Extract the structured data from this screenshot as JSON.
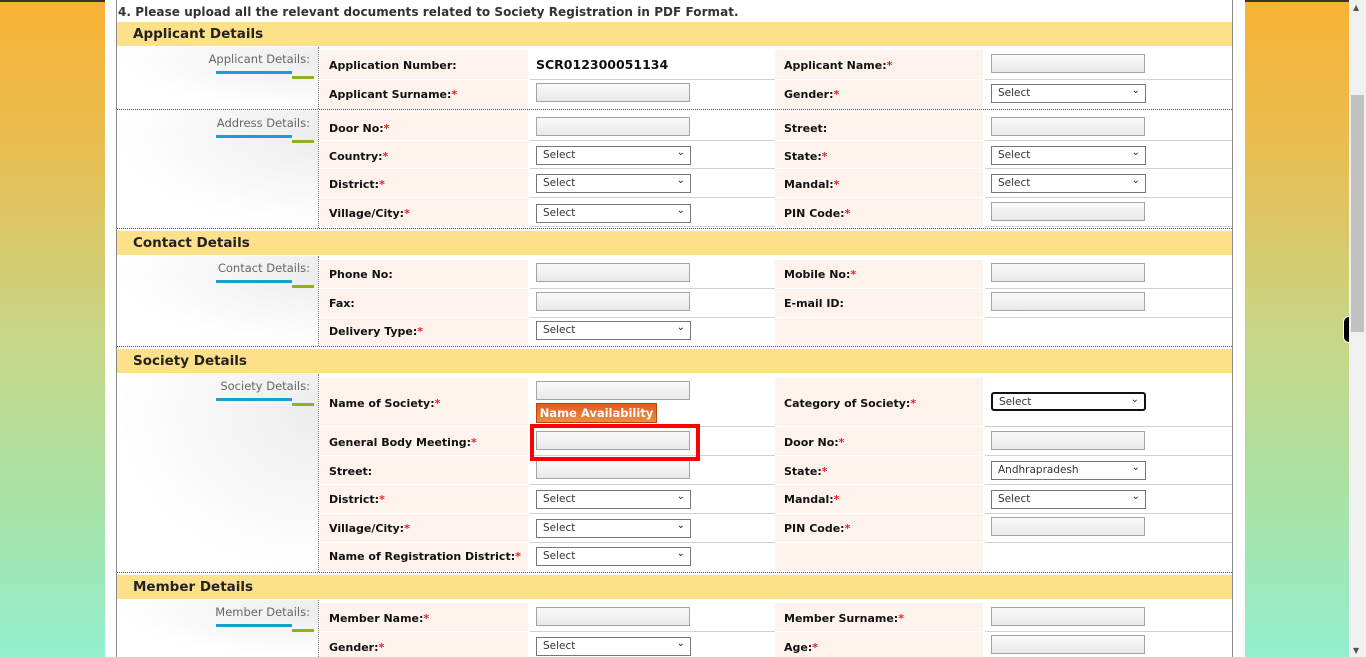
{
  "instruction_note": "4. Please upload all the relevant documents related to Society Registration in PDF Format.",
  "sections": {
    "applicant": {
      "header": "Applicant Details",
      "side_label": "Applicant Details:",
      "application_number_label": "Application Number:",
      "application_number_value": "SCR012300051134",
      "applicant_name_label": "Applicant Name:",
      "applicant_surname_label": "Applicant Surname:",
      "gender_label": "Gender:",
      "gender_value": "Select"
    },
    "address": {
      "side_label": "Address Details:",
      "door_label": "Door No:",
      "street_label": "Street:",
      "country_label": "Country:",
      "country_value": "Select",
      "state_label": "State:",
      "state_value": "Select",
      "district_label": "District:",
      "district_value": "Select",
      "mandal_label": "Mandal:",
      "mandal_value": "Select",
      "village_label": "Village/City:",
      "village_value": "Select",
      "pin_label": "PIN Code:"
    },
    "contact": {
      "header": "Contact Details",
      "side_label": "Contact Details:",
      "phone_label": "Phone No:",
      "mobile_label": "Mobile No:",
      "fax_label": "Fax:",
      "email_label": "E-mail ID:",
      "delivery_label": "Delivery Type:",
      "delivery_value": "Select"
    },
    "society": {
      "header": "Society Details",
      "side_label": "Society Details:",
      "name_label": "Name of  Society:",
      "name_availability_button": "Name Availability",
      "category_label": "Category of Society:",
      "category_value": "Select",
      "gbm_label": "General Body Meeting:",
      "door_label": "Door No:",
      "street_label": "Street:",
      "state_label": "State:",
      "state_value": "Andhrapradesh",
      "district_label": "District:",
      "district_value": "Select",
      "mandal_label": "Mandal:",
      "mandal_value": "Select",
      "village_label": "Village/City:",
      "village_value": "Select",
      "pin_label": "PIN Code:",
      "reg_district_label": "Name of Registration District:",
      "reg_district_value": "Select"
    },
    "member": {
      "header": "Member Details",
      "side_label": "Member Details:",
      "name_label": "Member Name:",
      "surname_label": "Member Surname:",
      "gender_label": "Gender:",
      "gender_value": "Select",
      "age_label": "Age:"
    }
  },
  "required_marker": "*",
  "icons": {
    "chevron": "⌵",
    "scroll_up": "▲",
    "scroll_down": "▼"
  },
  "colors": {
    "band": "#fde08a",
    "label_bg": "#fdf3ec",
    "required": "#e8202a",
    "button": "#e8702e",
    "highlight": "#ff0000"
  }
}
